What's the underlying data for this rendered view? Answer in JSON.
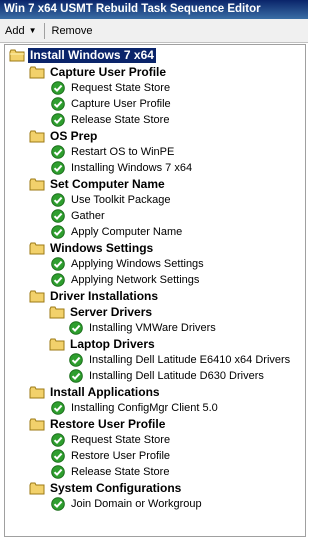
{
  "window": {
    "title": "Win 7 x64 USMT Rebuild Task Sequence Editor"
  },
  "toolbar": {
    "add_label": "Add",
    "remove_label": "Remove"
  },
  "tree": {
    "root": "Install Windows 7 x64",
    "groups": [
      {
        "label": "Capture User Profile",
        "items": [
          "Request State Store",
          "Capture User Profile",
          "Release State Store"
        ]
      },
      {
        "label": "OS Prep",
        "items": [
          "Restart OS to WinPE",
          "Installing Windows 7 x64"
        ]
      },
      {
        "label": "Set Computer Name",
        "items": [
          "Use Toolkit Package",
          "Gather",
          "Apply Computer Name"
        ]
      },
      {
        "label": "Windows Settings",
        "items": [
          "Applying Windows Settings",
          "Applying Network Settings"
        ]
      },
      {
        "label": "Driver Installations",
        "subgroups": [
          {
            "label": "Server Drivers",
            "items": [
              "Installing VMWare Drivers"
            ]
          },
          {
            "label": "Laptop Drivers",
            "items": [
              "Installing Dell Latitude E6410 x64 Drivers",
              "Installing Dell Latitude D630 Drivers"
            ]
          }
        ]
      },
      {
        "label": "Install Applications",
        "items": [
          "Installing ConfigMgr Client 5.0"
        ]
      },
      {
        "label": "Restore User Profile",
        "items": [
          "Request State Store",
          "Restore User Profile",
          "Release State Store"
        ]
      },
      {
        "label": "System Configurations",
        "items": [
          "Join Domain or Workgroup"
        ]
      }
    ]
  },
  "colors": {
    "titlebar": "#0a246a",
    "selection": "#0a246a",
    "check": "#2e9e2e",
    "folder": "#f2d16b"
  }
}
